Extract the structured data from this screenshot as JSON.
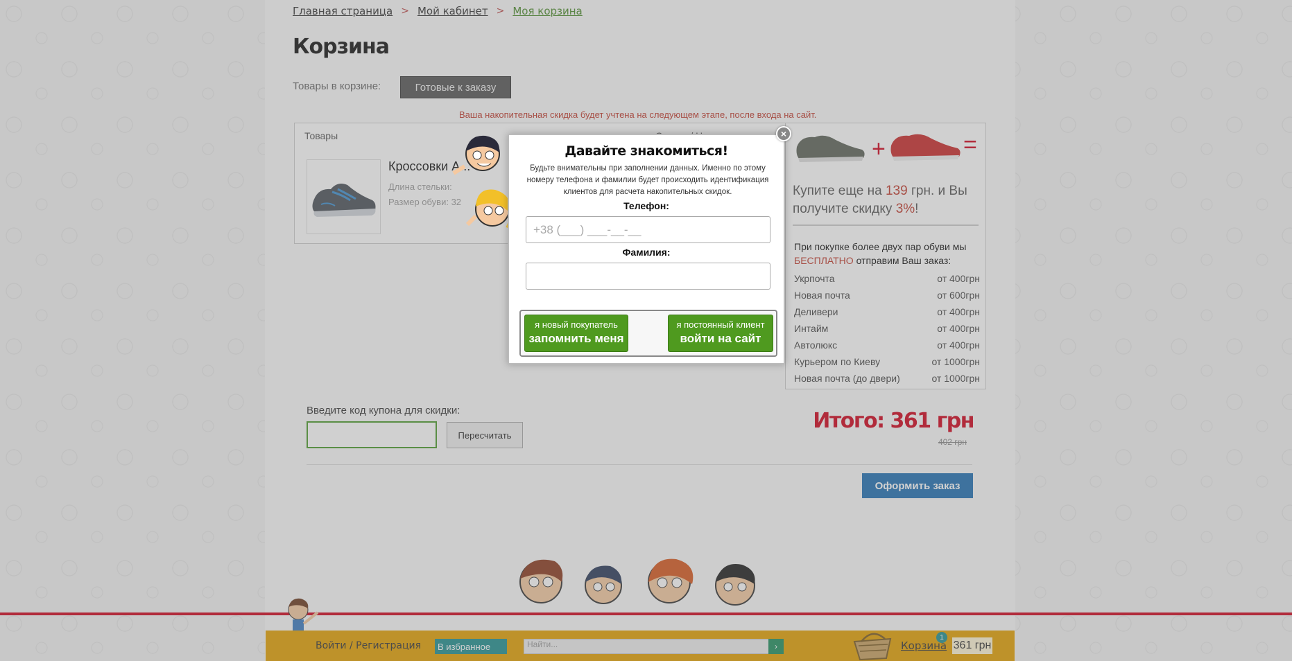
{
  "breadcrumb": {
    "home": "Главная страница",
    "cabinet": "Мой кабинет",
    "current": "Моя корзина",
    "separator": ">"
  },
  "page": {
    "title": "Корзина",
    "cart_label": "Товары в корзине:",
    "ready_button": "Готовые к заказу",
    "discount_note": "Ваша накопительная скидка будет учтена на следующем этапе, после входа на сайт."
  },
  "products": {
    "header": "Товары",
    "header2": "Скидка / Цена",
    "items": [
      {
        "name": "Кроссовки А...",
        "insole_label": "Длина стельки:",
        "size_label": "Размер обуви: 32"
      }
    ]
  },
  "promo": {
    "prefix": "Купите еще на ",
    "amount": "139",
    "middle": " грн. и Вы получите скидку ",
    "percent": "3%",
    "suffix": "!",
    "plus": "+",
    "equals": "="
  },
  "shipping": {
    "title_part1": "При покупке более двух пар обуви мы ",
    "title_free": "БЕСПЛАТНО",
    "title_part2": " отправим Ваш заказ:",
    "rows": [
      {
        "name": "Укрпочта",
        "price": "от 400грн"
      },
      {
        "name": "Новая почта",
        "price": "от 600грн"
      },
      {
        "name": "Деливери",
        "price": "от 400грн"
      },
      {
        "name": "Интайм",
        "price": "от 400грн"
      },
      {
        "name": "Автолюкс",
        "price": "от 400грн"
      },
      {
        "name": "Курьером по Киеву",
        "price": "от 1000грн"
      },
      {
        "name": "Новая почта (до двери)",
        "price": "от 1000грн"
      }
    ]
  },
  "coupon": {
    "label": "Введите код купона для скидки:",
    "value": "",
    "recalc_button": "Пересчитать"
  },
  "totals": {
    "total": "Итого: 361 грн",
    "old_total": "402 грн",
    "order_button": "Оформить заказ"
  },
  "modal": {
    "title": "Давайте знакомиться!",
    "description": "Будьте внимательны при заполнении данных. Именно по этому номеру телефона и фамилии будет происходить идентификация клиентов для расчета накопительных скидок.",
    "phone_label": "Телефон:",
    "phone_placeholder": "+38 (___) ___-__-__",
    "surname_label": "Фамилия:",
    "surname_value": "",
    "new_buyer_small": "я новый покупатель",
    "new_buyer_big": "запомнить меня",
    "regular_small": "я постоянный клиент",
    "regular_big": "войти на сайт",
    "close_icon": "×"
  },
  "footer": {
    "login": "Войти / Регистрация",
    "favorites": "В избранное",
    "search_placeholder": "Найти...",
    "search_go": "›",
    "cart": "Корзина",
    "cart_count": "1",
    "cart_sum": "361 грн"
  },
  "colors": {
    "accent_red": "#d0021b",
    "green": "#4f9a1f",
    "blue": "#1f6fb2",
    "footer": "#e3a000"
  }
}
